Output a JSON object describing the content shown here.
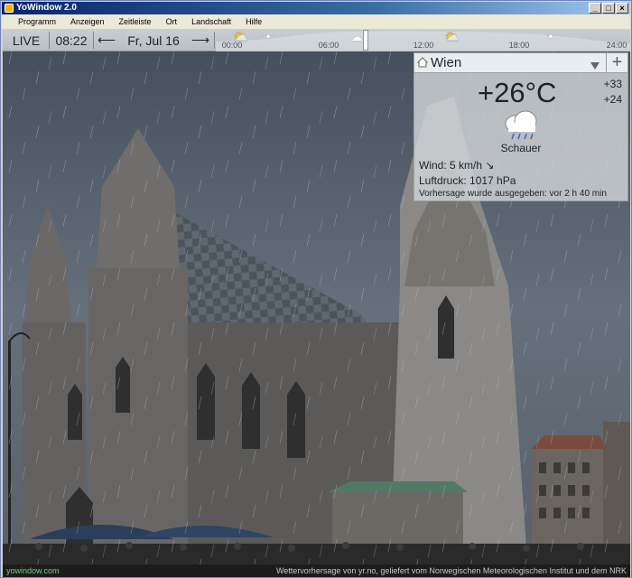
{
  "window": {
    "title": "YoWindow 2.0"
  },
  "menu": [
    "Programm",
    "Anzeigen",
    "Zeitleiste",
    "Ort",
    "Landschaft",
    "Hilfe"
  ],
  "toolbar": {
    "live": "LIVE",
    "time": "08:22",
    "prev_arrow": "⟵",
    "date": "Fr, Jul 16",
    "next_arrow": "⟶",
    "timeline_ticks": [
      "00:00",
      "06:00",
      "12:00",
      "18:00",
      "24:00"
    ]
  },
  "weather": {
    "city": "Wien",
    "temperature": "+26°C",
    "high": "+33",
    "low": "+24",
    "condition": "Schauer",
    "wind": "Wind:  5 km/h  ↘",
    "pressure": "Luftdruck:  1017 hPa",
    "issued": "Vorhersage wurde ausgegeben:  vor 2 h 40 min"
  },
  "footer": {
    "link": "yowindow.com",
    "credit": "Wettervorhersage von yr.no, geliefert vom Norwegischen Meteorologischen Institut und dem NRK"
  },
  "icons": {
    "timeline": [
      "partly-cloudy-icon",
      "sun-icon",
      "rain-cloud-icon",
      "partly-cloudy-icon",
      "sun-icon"
    ]
  }
}
